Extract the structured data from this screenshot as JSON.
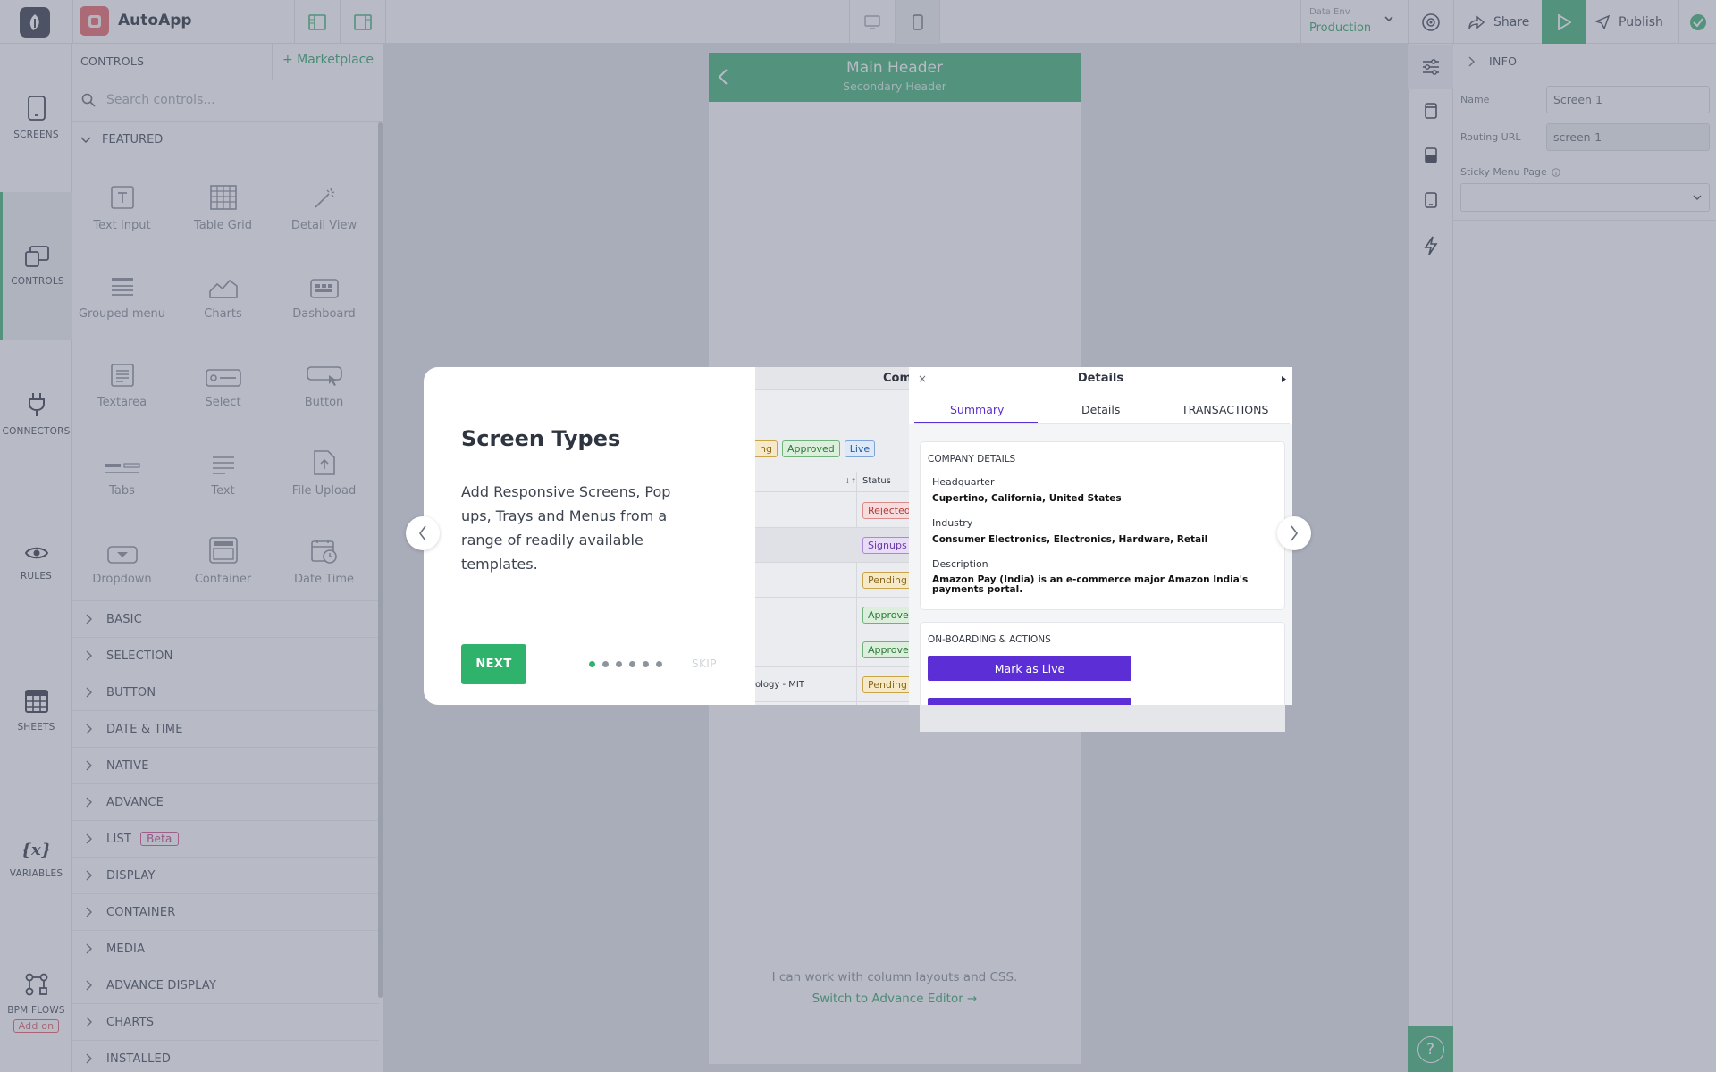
{
  "app": {
    "name": "AutoApp"
  },
  "topbar": {
    "env_label": "Data Env",
    "env_value": "Production",
    "share_label": "Share",
    "publish_label": "Publish"
  },
  "leftnav": {
    "items": [
      {
        "label": "SCREENS",
        "icon": "phone-icon"
      },
      {
        "label": "CONTROLS",
        "icon": "controls-icon"
      },
      {
        "label": "CONNECTORS",
        "icon": "plug-icon"
      },
      {
        "label": "RULES",
        "icon": "eye-icon"
      },
      {
        "label": "SHEETS",
        "icon": "sheet-icon"
      },
      {
        "label": "VARIABLES",
        "icon": "variables-icon"
      },
      {
        "label": "BPM FLOWS",
        "icon": "flow-icon"
      }
    ],
    "addon_label": "Add on",
    "variables_glyph": "{x}"
  },
  "controls": {
    "title": "CONTROLS",
    "marketplace": "+ Marketplace",
    "search_placeholder": "Search controls...",
    "featured_title": "FEATURED",
    "featured": [
      "Text Input",
      "Table Grid",
      "Detail View",
      "Grouped menu",
      "Charts",
      "Dashboard",
      "Textarea",
      "Select",
      "Button",
      "Tabs",
      "Text",
      "File Upload",
      "Dropdown",
      "Container",
      "Date Time"
    ],
    "categories": [
      "BASIC",
      "SELECTION",
      "BUTTON",
      "DATE & TIME",
      "NATIVE",
      "ADVANCE",
      "LIST",
      "DISPLAY",
      "CONTAINER",
      "MEDIA",
      "ADVANCE DISPLAY",
      "CHARTS",
      "INSTALLED"
    ],
    "list_badge": "Beta"
  },
  "canvas": {
    "main_header": "Main Header",
    "secondary_header": "Secondary Header",
    "hint": "I can work with column layouts and CSS.",
    "advance_link": "Switch to Advance Editor →"
  },
  "right_panel": {
    "info_title": "INFO",
    "name_label": "Name",
    "name_value": "Screen 1",
    "routing_label": "Routing URL",
    "routing_value": "screen-1",
    "sticky_label": "Sticky Menu Page",
    "help_glyph": "?"
  },
  "modal": {
    "title": "Screen Types",
    "body": "Add Responsive Screens, Pop ups, Trays and Menus from a range of readily available templates.",
    "next_label": "NEXT",
    "skip_label": "SKIP",
    "dots_total": 6,
    "dot_active": 1,
    "preview": {
      "partial_header": "Com",
      "status_header": "Status",
      "partial_tag": "ng",
      "tags": [
        "Approved",
        "Live"
      ],
      "row_statuses": [
        "Rejected",
        "Signups",
        "Pending",
        "Approved",
        "Approved",
        "Pending"
      ],
      "row_text": "ology - MIT",
      "details_title": "Details",
      "tabs": [
        "Summary",
        "Details",
        "TRANSACTIONS"
      ],
      "company_title": "COMPANY DETAILS",
      "hq_label": "Headquarter",
      "hq_value": "Cupertino, California, United States",
      "industry_label": "Industry",
      "industry_value": "Consumer Electronics, Electronics, Hardware, Retail",
      "desc_label": "Description",
      "desc_value": "Amazon Pay (India) is an e-commerce major Amazon India's payments portal.",
      "onboarding_title": "ON-BOARDING & ACTIONS",
      "action_label": "Mark as Live"
    }
  },
  "colors": {
    "accent": "#48b47a",
    "purple": "#5c2fd6"
  }
}
